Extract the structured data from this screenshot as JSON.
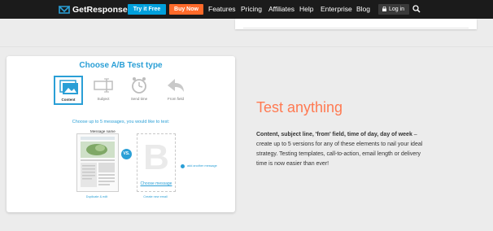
{
  "nav": {
    "logo": "GetResponse",
    "try_label": "Try it Free",
    "buy_label": "Buy Now",
    "links": [
      "Features",
      "Pricing",
      "Affiliates",
      "Help",
      "Enterprise",
      "Blog"
    ],
    "login_label": "Log in"
  },
  "panel": {
    "title": "Choose A/B Test type",
    "types": [
      "Content",
      "Subject",
      "Send time",
      "From field"
    ],
    "instruction": "Choose up to 5 messages, you would like to test:",
    "message_label": "Message name",
    "vs": "VS.",
    "b_letter": "B",
    "choose_message": "Choose message",
    "duplicate_edit": "Duplicate & edit",
    "create_new": "Create new email",
    "add_another": "add another message"
  },
  "feature": {
    "headline": "Test anything",
    "body_bold": "Content, subject line, 'from' field, time of day, day of week",
    "body_rest": " – create up to 5 versions for any of these elements to nail your ideal strategy. Testing templates, call-to-action, email length or delivery time is now easier than ever!"
  },
  "colors": {
    "accent": "#2a9fd6",
    "orange": "#ff6a2a",
    "headline": "#ff7a52",
    "navbar": "#1b1b1b"
  }
}
